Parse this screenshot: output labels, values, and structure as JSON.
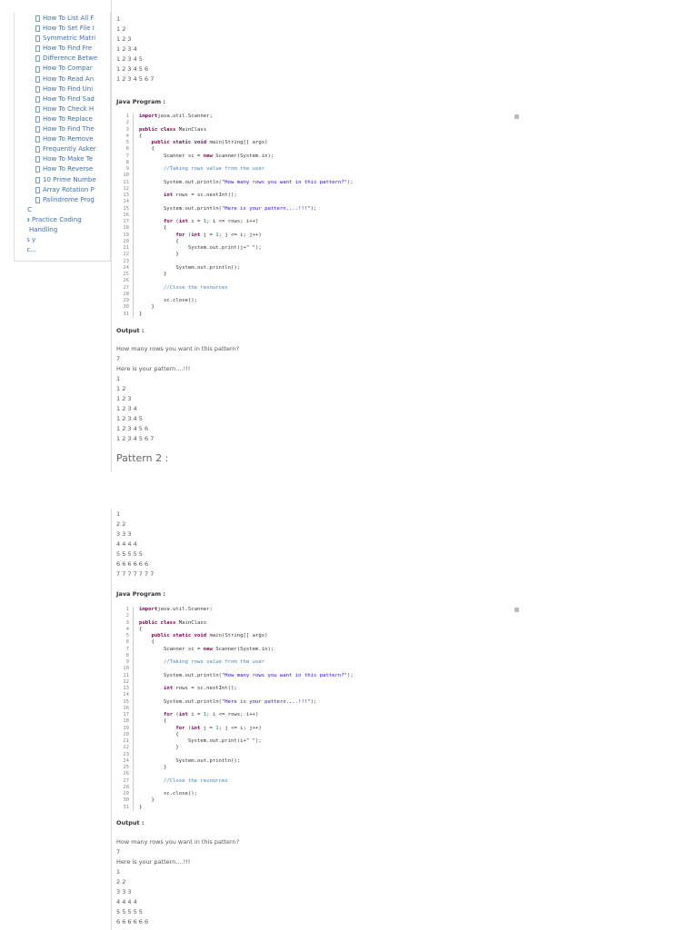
{
  "sidebar": {
    "pages": [
      "How To List All F",
      "How To Set File I",
      "Symmetric Matri",
      "How To Find Fre",
      "Difference Betwe",
      "How To Compar",
      "How To Read An",
      "How To Find Uni",
      "How To Find Sad",
      "How To Check H",
      "How To Replace",
      "How To Find The",
      "How To Remove",
      "Frequently Asker",
      "How To Make Te",
      "How To Reverse",
      "10 Prime Numbe",
      "Array Rotation P",
      "Palindrome Prog"
    ],
    "folders": [
      "JDBC",
      "Java Practice Coding",
      "File Handling",
      "x Vs y",
      "Misc..."
    ]
  },
  "pattern1": {
    "rows": [
      "1",
      "1 2",
      "1 2 3",
      "1 2 3 4",
      "1 2 3 4 5",
      "1 2 3 4 5 6",
      "1 2 3 4 5 6 7"
    ],
    "program_label": "Java Program :",
    "output_label": "Output :",
    "output": [
      "How many rows you want in this pattern?",
      "7",
      "Here is your pattern....!!!",
      "1",
      "1 2",
      "1 2 3",
      "1 2 3 4",
      "1 2 3 4 5",
      "1 2 3 4 5 6",
      "1 2 3 4 5 6 7"
    ],
    "code_print": "j"
  },
  "pattern2": {
    "title": "Pattern 2 :",
    "rows": [
      "1",
      "2 2",
      "3 3 3",
      "4 4 4 4",
      "5 5 5 5 5",
      "6 6 6 6 6 6",
      "7 7 7 7 7 7 7"
    ],
    "program_label": "Java Program :",
    "output_label": "Output :",
    "output": [
      "How many rows you want in this pattern?",
      "7",
      "Here is your pattern....!!!",
      "1",
      "2 2",
      "3 3 3",
      "4 4 4 4",
      "5 5 5 5 5",
      "6 6 6 6 6 6"
    ],
    "code_print": "i"
  }
}
